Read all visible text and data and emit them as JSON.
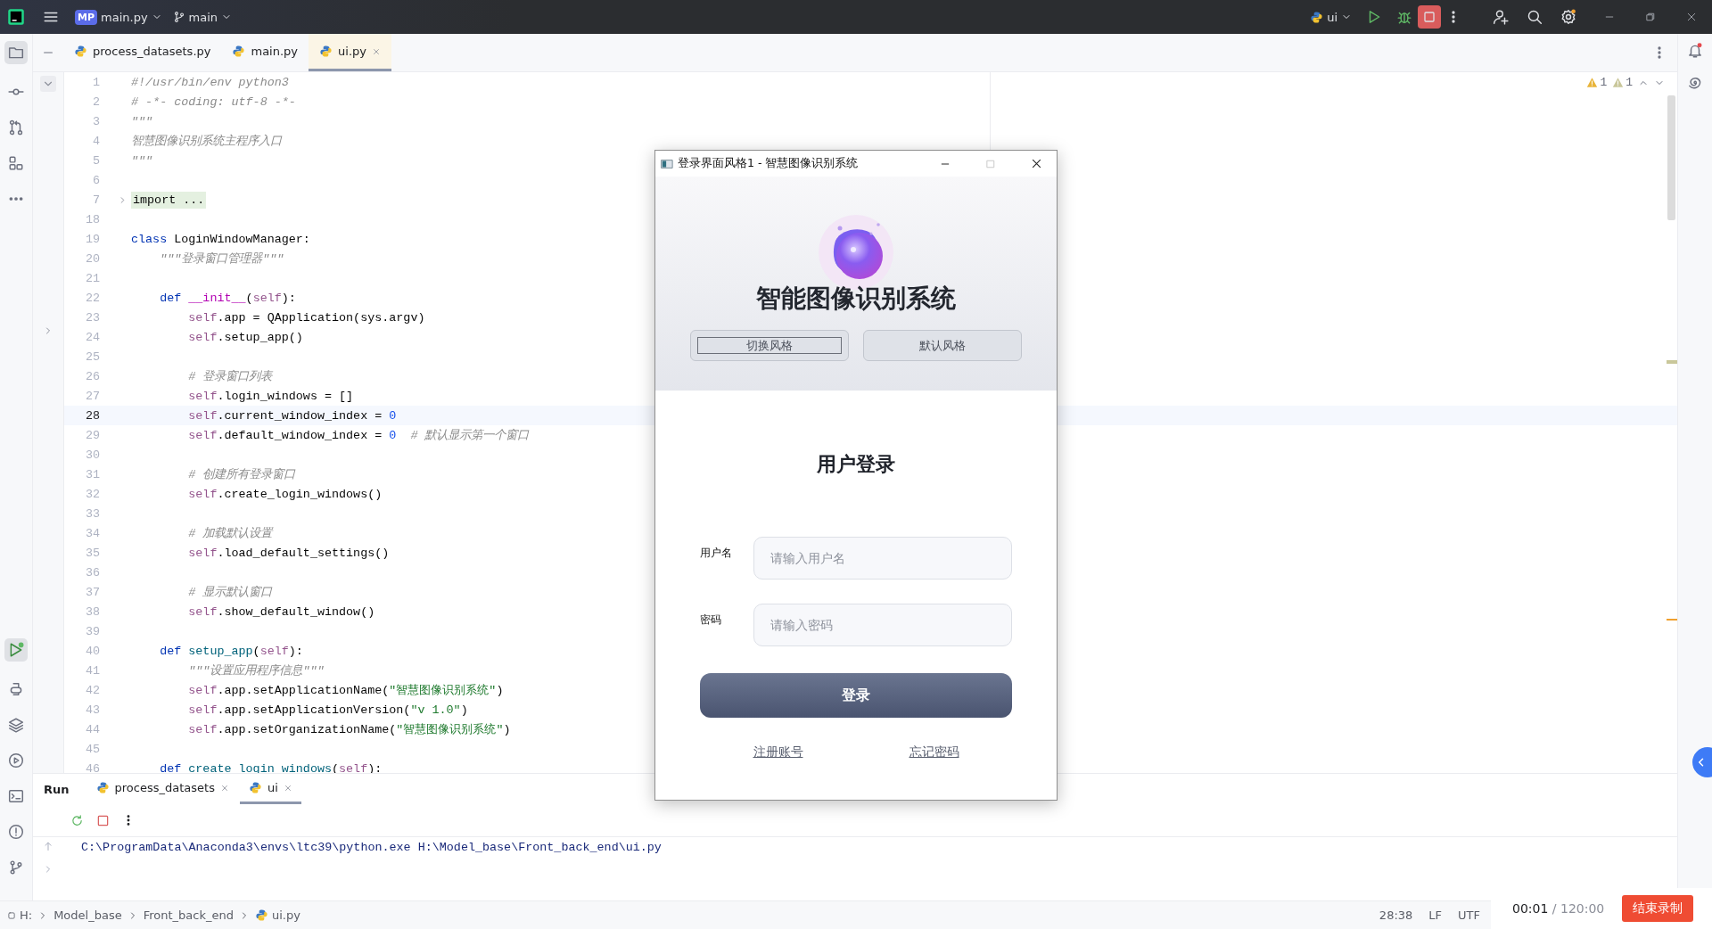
{
  "topbar": {
    "project_badge": "MP",
    "project": "main.py",
    "branch": "main",
    "run_config": "ui"
  },
  "editor_tabs": [
    {
      "label": "process_datasets.py",
      "selected": false,
      "closable": false
    },
    {
      "label": "main.py",
      "selected": false,
      "closable": false
    },
    {
      "label": "ui.py",
      "selected": true,
      "closable": true
    }
  ],
  "inspections": [
    {
      "kind": "warning",
      "count": "1"
    },
    {
      "kind": "weak",
      "count": "1"
    }
  ],
  "code_lines": [
    {
      "number": "1",
      "kind": "code",
      "current": false,
      "tokens": [
        {
          "kind": "comment",
          "text": "#!/usr/bin/env python3"
        }
      ]
    },
    {
      "number": "2",
      "kind": "code",
      "current": false,
      "tokens": [
        {
          "kind": "comment",
          "text": "# -*- coding: utf-8 -*-"
        }
      ]
    },
    {
      "number": "3",
      "kind": "code",
      "current": false,
      "tokens": [
        {
          "kind": "comment",
          "text": "\"\"\""
        }
      ]
    },
    {
      "number": "4",
      "kind": "code",
      "current": false,
      "tokens": [
        {
          "kind": "comment",
          "text": "智慧图像识别系统主程序入口"
        }
      ]
    },
    {
      "number": "5",
      "kind": "code",
      "current": false,
      "tokens": [
        {
          "kind": "comment",
          "text": "\"\"\""
        }
      ]
    },
    {
      "number": "6",
      "kind": "code",
      "current": false
    },
    {
      "number": "7",
      "kind": "folded",
      "current": false,
      "tokens": [
        {
          "kind": "folded",
          "text": "import ..."
        }
      ]
    },
    {
      "number": "18",
      "kind": "code",
      "current": false
    },
    {
      "number": "19",
      "kind": "code",
      "current": false,
      "tokens": [
        {
          "kind": "keyword",
          "text": "class"
        },
        {
          "kind": "plain",
          "text": " LoginWindowManager:"
        }
      ]
    },
    {
      "number": "20",
      "kind": "code",
      "current": false,
      "tokens": [
        {
          "kind": "comment",
          "text": "    \"\"\"登录窗口管理器\"\"\""
        }
      ]
    },
    {
      "number": "21",
      "kind": "code",
      "current": false
    },
    {
      "number": "22",
      "kind": "code",
      "current": false,
      "tokens": [
        {
          "kind": "keyword",
          "text": "    def"
        },
        {
          "kind": "magic",
          "text": " __init__"
        },
        {
          "kind": "plain",
          "text": "("
        },
        {
          "kind": "self",
          "text": "self"
        },
        {
          "kind": "plain",
          "text": "):"
        }
      ]
    },
    {
      "number": "23",
      "kind": "code",
      "current": false,
      "tokens": [
        {
          "kind": "self",
          "text": "        self"
        },
        {
          "kind": "plain",
          "text": ".app = QApplication(sys.argv)"
        }
      ]
    },
    {
      "number": "24",
      "kind": "code",
      "current": false,
      "tokens": [
        {
          "kind": "self",
          "text": "        self"
        },
        {
          "kind": "plain",
          "text": ".setup_app()"
        }
      ]
    },
    {
      "number": "25",
      "kind": "code",
      "current": false
    },
    {
      "number": "26",
      "kind": "code",
      "current": false,
      "tokens": [
        {
          "kind": "comment",
          "text": "        # 登录窗口列表"
        }
      ]
    },
    {
      "number": "27",
      "kind": "code",
      "current": false,
      "tokens": [
        {
          "kind": "self",
          "text": "        self"
        },
        {
          "kind": "plain",
          "text": ".login_windows = []"
        }
      ]
    },
    {
      "number": "28",
      "kind": "code",
      "current": true,
      "tokens": [
        {
          "kind": "self",
          "text": "        self"
        },
        {
          "kind": "plain",
          "text": ".current_window_index = "
        },
        {
          "kind": "number",
          "text": "0"
        }
      ]
    },
    {
      "number": "29",
      "kind": "code",
      "current": false,
      "tokens": [
        {
          "kind": "self",
          "text": "        self"
        },
        {
          "kind": "plain",
          "text": ".default_window_index = "
        },
        {
          "kind": "number",
          "text": "0"
        },
        {
          "kind": "comment",
          "text": "  # 默认显示第一个窗口"
        }
      ]
    },
    {
      "number": "30",
      "kind": "code",
      "current": false
    },
    {
      "number": "31",
      "kind": "code",
      "current": false,
      "tokens": [
        {
          "kind": "comment",
          "text": "        # 创建所有登录窗口"
        }
      ]
    },
    {
      "number": "32",
      "kind": "code",
      "current": false,
      "tokens": [
        {
          "kind": "self",
          "text": "        self"
        },
        {
          "kind": "plain",
          "text": ".create_login_windows()"
        }
      ]
    },
    {
      "number": "33",
      "kind": "code",
      "current": false
    },
    {
      "number": "34",
      "kind": "code",
      "current": false,
      "tokens": [
        {
          "kind": "comment",
          "text": "        # 加载默认设置"
        }
      ]
    },
    {
      "number": "35",
      "kind": "code",
      "current": false,
      "tokens": [
        {
          "kind": "self",
          "text": "        self"
        },
        {
          "kind": "plain",
          "text": ".load_default_settings()"
        }
      ]
    },
    {
      "number": "36",
      "kind": "code",
      "current": false
    },
    {
      "number": "37",
      "kind": "code",
      "current": false,
      "tokens": [
        {
          "kind": "comment",
          "text": "        # 显示默认窗口"
        }
      ]
    },
    {
      "number": "38",
      "kind": "code",
      "current": false,
      "tokens": [
        {
          "kind": "self",
          "text": "        self"
        },
        {
          "kind": "plain",
          "text": ".show_default_window()"
        }
      ]
    },
    {
      "number": "39",
      "kind": "code",
      "current": false
    },
    {
      "number": "40",
      "kind": "code",
      "current": false,
      "tokens": [
        {
          "kind": "keyword",
          "text": "    def"
        },
        {
          "kind": "function",
          "text": " setup_app"
        },
        {
          "kind": "plain",
          "text": "("
        },
        {
          "kind": "self",
          "text": "self"
        },
        {
          "kind": "plain",
          "text": "):"
        }
      ]
    },
    {
      "number": "41",
      "kind": "code",
      "current": false,
      "tokens": [
        {
          "kind": "comment",
          "text": "        \"\"\"设置应用程序信息\"\"\""
        }
      ]
    },
    {
      "number": "42",
      "kind": "code",
      "current": false,
      "tokens": [
        {
          "kind": "self",
          "text": "        self"
        },
        {
          "kind": "plain",
          "text": ".app.setApplicationName("
        },
        {
          "kind": "string",
          "text": "\"智慧图像识别系统\""
        },
        {
          "kind": "plain",
          "text": ")"
        }
      ]
    },
    {
      "number": "43",
      "kind": "code",
      "current": false,
      "tokens": [
        {
          "kind": "self",
          "text": "        self"
        },
        {
          "kind": "plain",
          "text": ".app.setApplicationVersion("
        },
        {
          "kind": "string",
          "text": "\"v 1.0\""
        },
        {
          "kind": "plain",
          "text": ")"
        }
      ]
    },
    {
      "number": "44",
      "kind": "code",
      "current": false,
      "tokens": [
        {
          "kind": "self",
          "text": "        self"
        },
        {
          "kind": "plain",
          "text": ".app.setOrganizationName("
        },
        {
          "kind": "string",
          "text": "\"智慧图像识别系统\""
        },
        {
          "kind": "plain",
          "text": ")"
        }
      ]
    },
    {
      "number": "45",
      "kind": "code",
      "current": false
    },
    {
      "number": "46",
      "kind": "code",
      "current": false,
      "tokens": [
        {
          "kind": "keyword",
          "text": "    def"
        },
        {
          "kind": "function",
          "text": " create_login_windows"
        },
        {
          "kind": "plain",
          "text": "("
        },
        {
          "kind": "self",
          "text": "self"
        },
        {
          "kind": "plain",
          "text": "):"
        }
      ]
    }
  ],
  "run_panel": {
    "title": "Run",
    "tabs": [
      {
        "label": "process_datasets",
        "selected": false
      },
      {
        "label": "ui",
        "selected": true
      }
    ],
    "output": "C:\\ProgramData\\Anaconda3\\envs\\ltc39\\python.exe H:\\Model_base\\Front_back_end\\ui.py"
  },
  "status_bar": {
    "breadcrumbs": [
      "H:",
      "Model_base",
      "Front_back_end",
      "ui.py"
    ],
    "position": "28:38",
    "line_separator": "LF",
    "encoding": "UTF"
  },
  "recording": {
    "elapsed": "00:01",
    "limit": "/ 120:00",
    "stop_label": "结束录制"
  },
  "dialog": {
    "title": "登录界面风格1 - 智慧图像识别系统",
    "app_title": "智能图像识别系统",
    "style_buttons": [
      {
        "label": "切换风格",
        "focused": true
      },
      {
        "label": "默认风格",
        "focused": false
      }
    ],
    "heading": "用户登录",
    "fields": [
      {
        "label": "用户名",
        "placeholder": "请输入用户名"
      },
      {
        "label": "密码",
        "placeholder": "请输入密码"
      }
    ],
    "login_label": "登录",
    "links": [
      "注册账号",
      "忘记密码"
    ]
  }
}
